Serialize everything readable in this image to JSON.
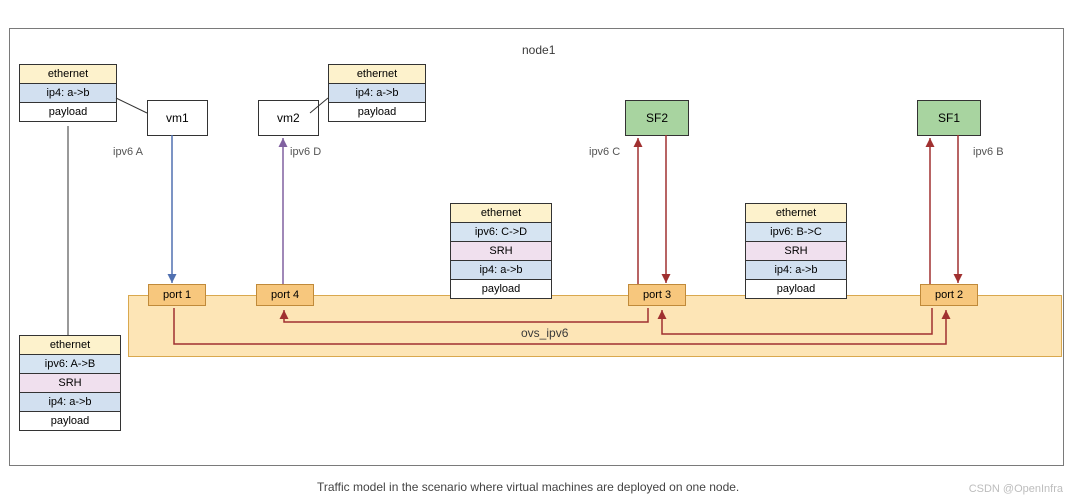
{
  "node": {
    "title": "node1"
  },
  "stack_tl": {
    "eth": "ethernet",
    "ip4": "ip4: a->b",
    "pay": "payload"
  },
  "stack_tr": {
    "eth": "ethernet",
    "ip4": "ip4: a->b",
    "pay": "payload"
  },
  "stack_bl": {
    "eth": "ethernet",
    "ip6": "ipv6: A->B",
    "srh": "SRH",
    "ip4": "ip4: a->b",
    "pay": "payload"
  },
  "stack_mid": {
    "eth": "ethernet",
    "ip6": "ipv6: C->D",
    "srh": "SRH",
    "ip4": "ip4: a->b",
    "pay": "payload"
  },
  "stack_right": {
    "eth": "ethernet",
    "ip6": "ipv6: B->C",
    "srh": "SRH",
    "ip4": "ip4: a->b",
    "pay": "payload"
  },
  "vm1": "vm1",
  "vm2": "vm2",
  "sf1": "SF1",
  "sf2": "SF2",
  "ports": {
    "p1": "port 1",
    "p2": "port 2",
    "p3": "port 3",
    "p4": "port 4"
  },
  "ovs": "ovs_ipv6",
  "labels": {
    "ipv6A": "ipv6 A",
    "ipv6B": "ipv6 B",
    "ipv6C": "ipv6 C",
    "ipv6D": "ipv6 D"
  },
  "caption": "Traffic model in the scenario where virtual machines are deployed on one node.",
  "watermark": "CSDN @OpenInfra"
}
